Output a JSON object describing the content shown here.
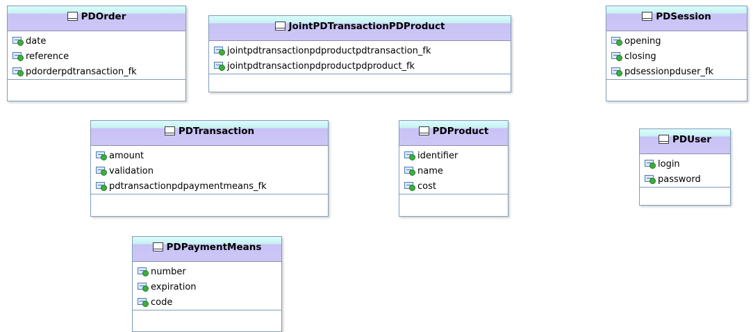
{
  "entities": [
    {
      "name": "PDOrder",
      "attributes": [
        "date",
        "reference",
        "pdorderpdtransaction_fk"
      ]
    },
    {
      "name": "JointPDTransactionPDProduct",
      "attributes": [
        "jointpdtransactionpdproductpdtransaction_fk",
        "jointpdtransactionpdproductpdproduct_fk"
      ]
    },
    {
      "name": "PDSession",
      "attributes": [
        "opening",
        "closing",
        "pdsessionpduser_fk"
      ]
    },
    {
      "name": "PDTransaction",
      "attributes": [
        "amount",
        "validation",
        "pdtransactionpdpaymentmeans_fk"
      ]
    },
    {
      "name": "PDProduct",
      "attributes": [
        "identifier",
        "name",
        "cost"
      ]
    },
    {
      "name": "PDUser",
      "attributes": [
        "login",
        "password"
      ]
    },
    {
      "name": "PDPaymentMeans",
      "attributes": [
        "number",
        "expiration",
        "code"
      ]
    }
  ]
}
